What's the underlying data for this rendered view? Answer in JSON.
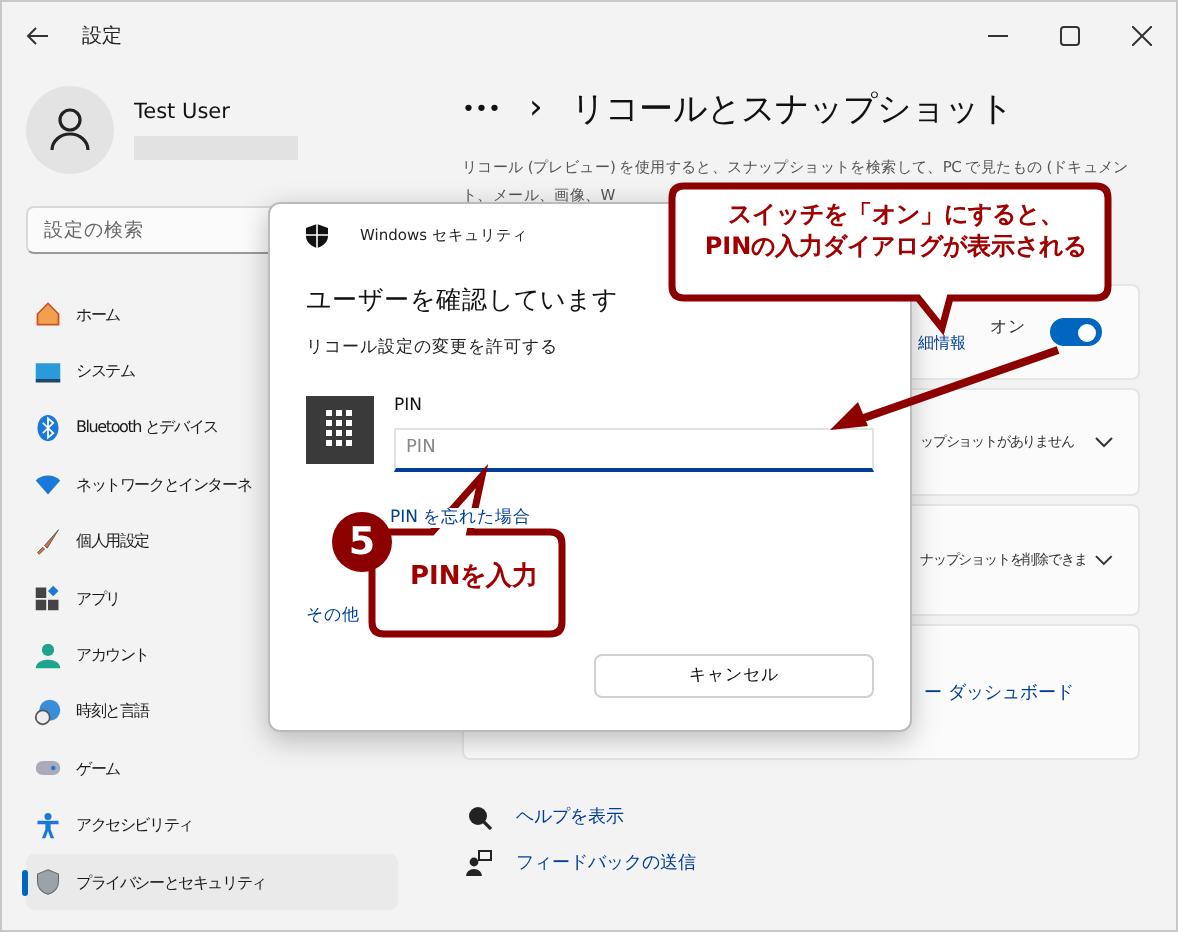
{
  "window": {
    "title": "設定"
  },
  "user": {
    "name": "Test User"
  },
  "search": {
    "placeholder": "設定の検索"
  },
  "nav": [
    {
      "label": "ホーム",
      "selected": false
    },
    {
      "label": "システム",
      "selected": false
    },
    {
      "label": "Bluetooth とデバイス",
      "selected": false
    },
    {
      "label": "ネットワークとインターネ",
      "selected": false
    },
    {
      "label": "個人用設定",
      "selected": false
    },
    {
      "label": "アプリ",
      "selected": false
    },
    {
      "label": "アカウント",
      "selected": false
    },
    {
      "label": "時刻と言語",
      "selected": false
    },
    {
      "label": "ゲーム",
      "selected": false
    },
    {
      "label": "アクセシビリティ",
      "selected": false
    },
    {
      "label": "プライバシーとセキュリティ",
      "selected": true
    }
  ],
  "breadcrumb": {
    "ellipsis": "•••",
    "separator": "›",
    "title": "リコールとスナップショット"
  },
  "description": [
    "リコール (プレビュー) を使用すると、スナップショットを検索して、PC で見たもの (ドキュメン",
    "ト、メール、画像、W"
  ],
  "cards": [
    {
      "kind": "toggle",
      "link": "細情報",
      "state_label": "オン",
      "on": true
    },
    {
      "kind": "expander",
      "text": "ップショットがありません"
    },
    {
      "kind": "expander",
      "text": "ナップショットを削除できま"
    },
    {
      "kind": "links",
      "link": "ー ダッシュボード"
    }
  ],
  "footer_links": [
    {
      "label": "ヘルプを表示"
    },
    {
      "label": "フィードバックの送信"
    }
  ],
  "dialog": {
    "app": "Windows セキュリティ",
    "heading": "ユーザーを確認しています",
    "message": "リコール設定の変更を許可する",
    "pin_label": "PIN",
    "placeholder": "PIN",
    "forgot": "PIN を忘れた場合",
    "more": "その他",
    "cancel": "キャンセル"
  },
  "callouts": [
    {
      "text": [
        "スイッチを「オン」にすると、",
        "PINの入力ダイアログが表示される"
      ]
    },
    {
      "step": "5",
      "text": [
        "PINを入力"
      ]
    }
  ]
}
